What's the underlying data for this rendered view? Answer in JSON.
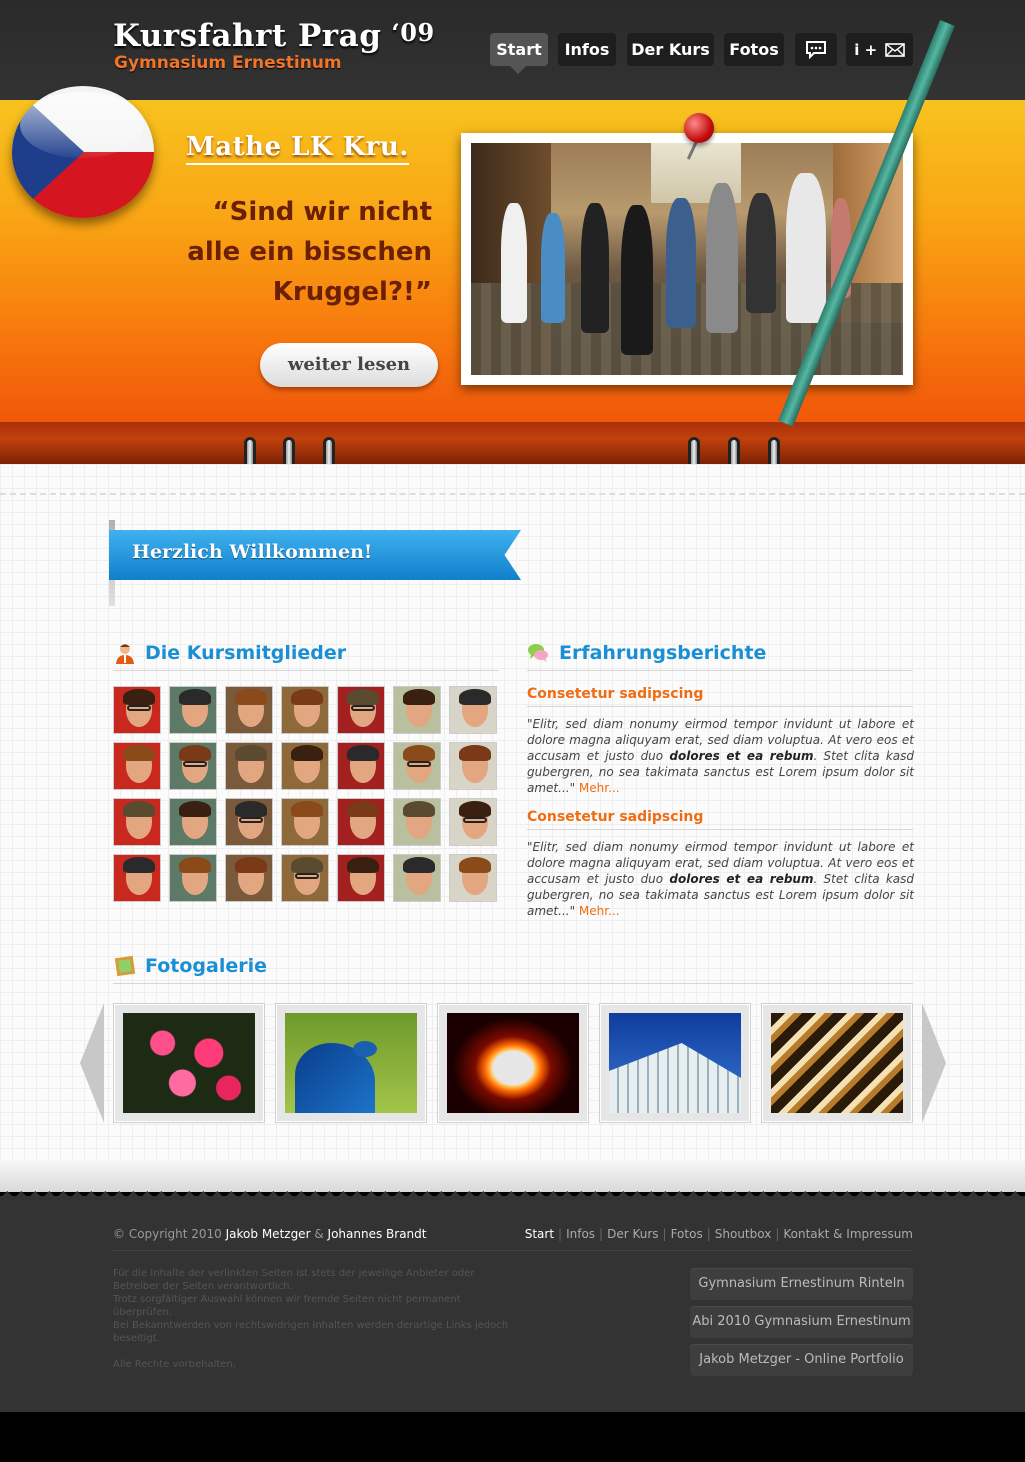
{
  "header": {
    "title": "Kursfahrt Prag",
    "year": "‘09",
    "subtitle": "Gymnasium Ernestinum"
  },
  "nav": {
    "items": [
      {
        "label": "Start",
        "active": true
      },
      {
        "label": "Infos"
      },
      {
        "label": "Der Kurs"
      },
      {
        "label": "Fotos"
      }
    ],
    "icons": [
      "speech-bubble-icon",
      "info-mail-icon"
    ],
    "info_mail_label": "i +"
  },
  "hero": {
    "heading": "Mathe LK Kru.",
    "quote_lines": [
      "“Sind wir nicht",
      "alle ein bisschen",
      "Kruggel?!”"
    ],
    "button": "weiter lesen",
    "flag_colors": {
      "white": "#f4f4f4",
      "red": "#d5151f",
      "blue": "#1e3e8c"
    }
  },
  "welcome": {
    "banner": "Herzlich Willkommen!"
  },
  "members": {
    "title": "Die Kursmitglieder"
  },
  "reports": {
    "title": "Erfahrungsberichte",
    "items": [
      {
        "title": "Consetetur sadipscing",
        "text_a": "\"Elitr, sed diam nonumy eirmod tempor invidunt ut labore et dolore magna aliquyam erat, sed diam voluptua. At vero eos et accusam et justo duo ",
        "text_bold": "dolores et ea rebum",
        "text_b": ". Stet clita kasd gubergren, no sea takimata sanctus est Lorem ipsum dolor sit amet...\" ",
        "more": "Mehr..."
      },
      {
        "title": "Consetetur sadipscing",
        "text_a": "\"Elitr, sed diam nonumy eirmod tempor invidunt ut labore et dolore magna aliquyam erat, sed diam voluptua. At vero eos et accusam et justo duo ",
        "text_bold": "dolores et ea rebum",
        "text_b": ". Stet clita kasd gubergren, no sea takimata sanctus est Lorem ipsum dolor sit amet...\" ",
        "more": "Mehr..."
      }
    ]
  },
  "gallery": {
    "title": "Fotogalerie"
  },
  "footer": {
    "copyright_prefix": "© Copyright 2010",
    "author1": "Jakob Metzger",
    "amp": "&",
    "author2": "Johannes Brandt",
    "nav": [
      "Start",
      "Infos",
      "Der Kurs",
      "Fotos",
      "Shoutbox",
      "Kontakt & Impressum"
    ],
    "disclaimer": "Für die Inhalte der verlinkten Seiten ist stets der jeweilige Anbieter oder Betreiber der Seiten verantwortlich.\nTrotz sorgfältiger Auswahl können wir fremde Seiten nicht permanent überprüfen.\nBei Bekanntwerden von rechtswidrigen Inhalten werden derartige Links jedoch beseitigt.",
    "rights": "Alle Rechte vorbehalten.",
    "links": [
      "Gymnasium Ernestinum Rinteln",
      "Abi 2010 Gymnasium Ernestinum",
      "Jakob Metzger - Online Portfolio"
    ]
  },
  "colors": {
    "accent_orange": "#f06c12",
    "accent_blue": "#1b8fd4",
    "dark_bg": "#333333"
  }
}
